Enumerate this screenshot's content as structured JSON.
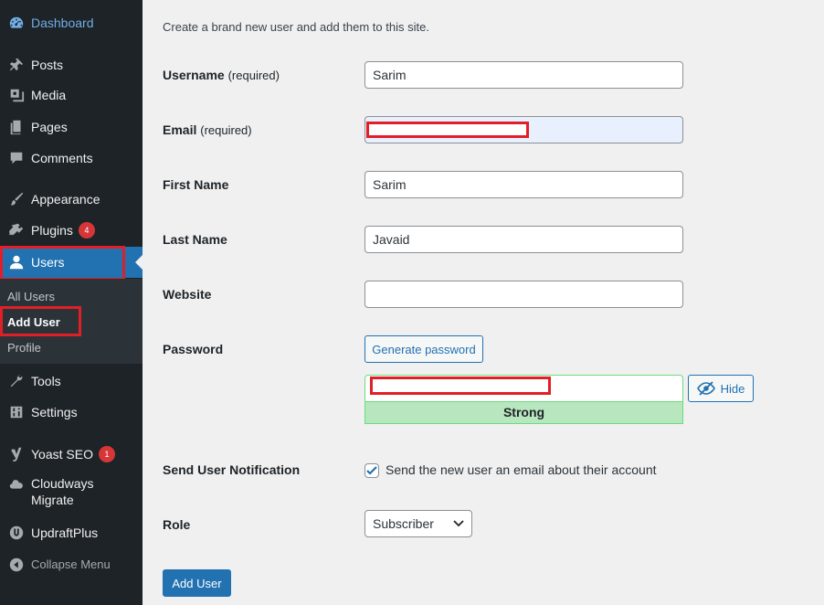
{
  "sidebar": {
    "items": [
      {
        "label": "Dashboard",
        "icon": "dashboard-icon"
      },
      {
        "label": "Posts",
        "icon": "pin-icon"
      },
      {
        "label": "Media",
        "icon": "media-icon"
      },
      {
        "label": "Pages",
        "icon": "pages-icon"
      },
      {
        "label": "Comments",
        "icon": "comment-icon"
      },
      {
        "label": "Appearance",
        "icon": "paintbrush-icon"
      },
      {
        "label": "Plugins",
        "icon": "plugin-icon",
        "badge": "4"
      },
      {
        "label": "Users",
        "icon": "user-icon"
      },
      {
        "label": "Tools",
        "icon": "wrench-icon"
      },
      {
        "label": "Settings",
        "icon": "settings-icon"
      },
      {
        "label": "Yoast SEO",
        "icon": "yoast-icon",
        "badge": "1"
      },
      {
        "label_line1": "Cloudways",
        "label_line2": "Migrate",
        "icon": "cloud-icon"
      },
      {
        "label": "UpdraftPlus",
        "icon": "updraft-icon"
      },
      {
        "label": "Collapse Menu",
        "icon": "collapse-icon"
      }
    ],
    "submenu": [
      "All Users",
      "Add User",
      "Profile"
    ]
  },
  "form": {
    "intro": "Create a brand new user and add them to this site.",
    "username_label": "Username",
    "username_req": "(required)",
    "username_value": "Sarim",
    "email_label": "Email",
    "email_req": "(required)",
    "first_name_label": "First Name",
    "first_name_value": "Sarim",
    "last_name_label": "Last Name",
    "last_name_value": "Javaid",
    "website_label": "Website",
    "password_label": "Password",
    "generate_password": "Generate password",
    "hide_label": "Hide",
    "strength": "Strong",
    "notification_label": "Send User Notification",
    "notification_text": "Send the new user an email about their account",
    "role_label": "Role",
    "role_value": "Subscriber",
    "submit": "Add User"
  },
  "colors": {
    "sidebar_bg": "#1d2327",
    "accent": "#2271b1",
    "highlight_box": "#e11f26",
    "strength_bg": "#b8e6bf"
  }
}
